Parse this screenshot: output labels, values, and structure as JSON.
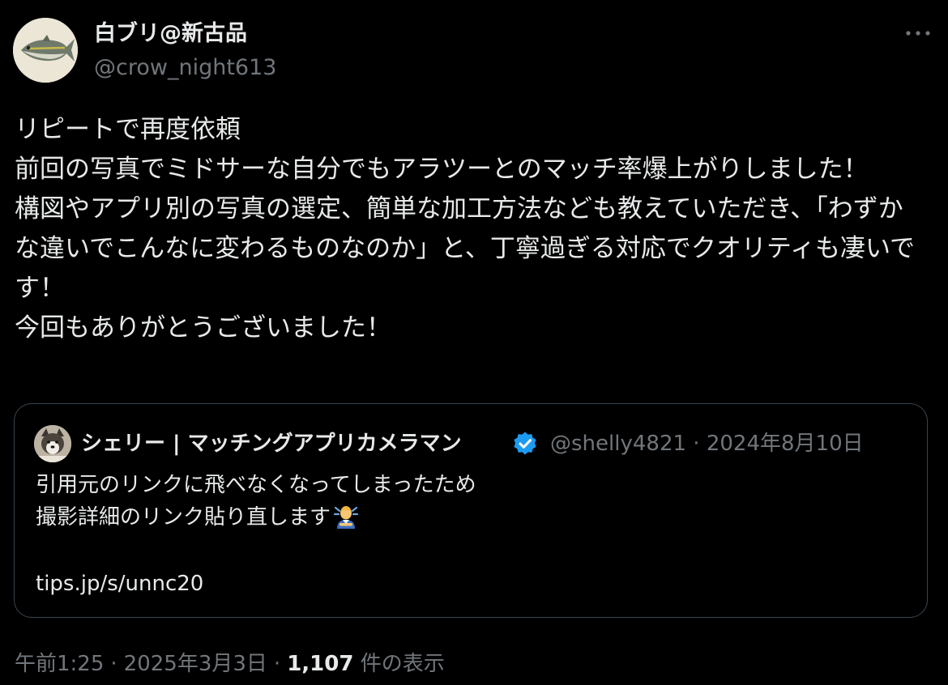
{
  "author": {
    "display_name": "白ブリ@新古品",
    "handle": "@crow_night613",
    "avatar_icon": "fish-avatar-icon"
  },
  "more_icon": "more-horizontal-icon",
  "tweet": {
    "text": "リピートで再度依頼\n前回の写真でミドサーな自分でもアラツーとのマッチ率爆上がりしました！\n構図やアプリ別の写真の選定、簡単な加工方法なども教えていただき、「わずかな違いでこんなに変わるものなのか」と、丁寧過ぎる対応でクオリティも凄いです！\n今回もありがとうございました！"
  },
  "quote": {
    "display_name": "シェリー | マッチングアプリカメラマン",
    "handle": "@shelly4821",
    "separator": "·",
    "date": "2024年8月10日",
    "verified_color": "#1d9bf0",
    "text": "引用元のリンクに飛べなくなってしまったため\n撮影詳細のリンク貼り直します",
    "emoji_icon": "person-bowing-emoji-icon",
    "link": "tips.jp/s/unnc20",
    "avatar_icon": "dog-avatar-icon"
  },
  "footer": {
    "time": "午前1:25",
    "sep1": "·",
    "date": "2025年3月3日",
    "sep2": "·",
    "views_count": "1,107",
    "views_label": "件の表示"
  },
  "colors": {
    "background": "#000000",
    "text": "#e7e9ea",
    "muted": "#71767b",
    "border": "#38444d",
    "accent": "#1d9bf0"
  }
}
